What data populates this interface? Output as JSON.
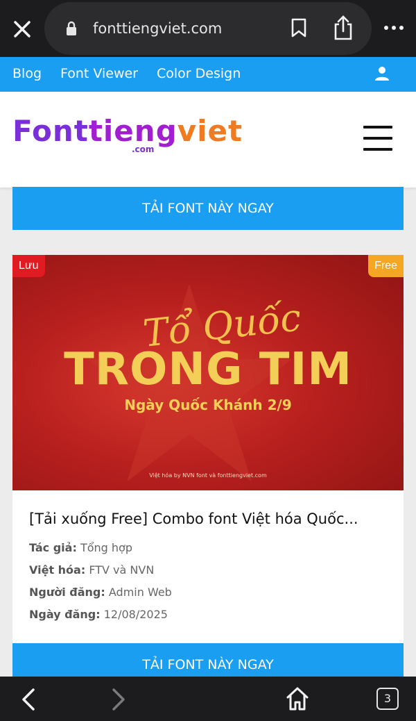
{
  "browser": {
    "url": "fonttiengviet.com",
    "tab_count": "3"
  },
  "nav": {
    "links": [
      "Blog",
      "Font Viewer",
      "Color Design"
    ]
  },
  "logo": {
    "part1": "Font",
    "part2": "tieng",
    "part3": "viet",
    "suffix": ".com"
  },
  "buttons": {
    "download_label": "TẢI FONT NÀY NGAY"
  },
  "card": {
    "badge_save": "Lưu",
    "badge_free": "Free",
    "banner": {
      "script": "Tổ Quốc",
      "headline": "TRONG TIM",
      "subtitle": "Ngày Quốc Khánh 2/9",
      "credit": "Việt hóa by NVN font và fonttiengviet.com"
    },
    "title": "[Tải xuống Free] Combo font Việt hóa Quốc...",
    "meta": [
      {
        "label": "Tác giả:",
        "value": "Tổng hợp"
      },
      {
        "label": "Việt hóa:",
        "value": "FTV và NVN"
      },
      {
        "label": "Người đăng:",
        "value": "Admin Web"
      },
      {
        "label": "Ngày đăng:",
        "value": "12/08/2025"
      }
    ]
  },
  "colors": {
    "nav_blue": "#1a9ef2",
    "badge_red": "#e11b22",
    "badge_orange": "#f5a623",
    "banner_red": "#b8201e",
    "banner_gold": "#f3cf58"
  }
}
